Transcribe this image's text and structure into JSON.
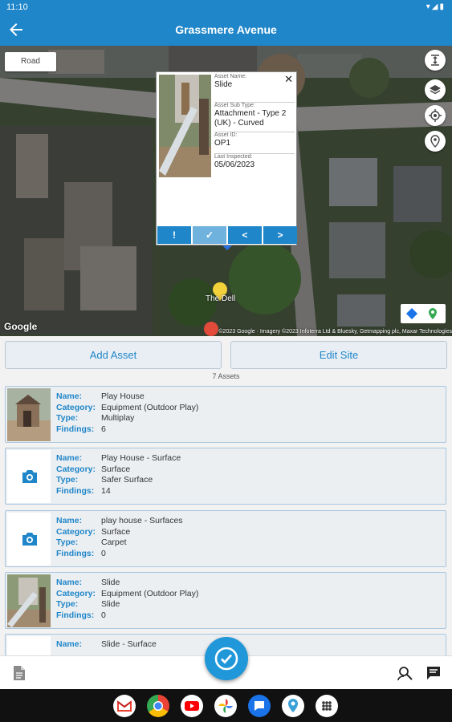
{
  "status": {
    "time": "11:10",
    "system_icons": "▾◢▮"
  },
  "appbar": {
    "title": "Grassmere Avenue"
  },
  "map": {
    "type_button": "Road",
    "google_logo": "Google",
    "attribution": "©2023 Google · Imagery ©2023 Infoterra Ltd & Bluesky, Getmapping plc, Maxar Technologies",
    "poi_label": "The Dell"
  },
  "popup": {
    "asset_name_label": "Asset Name:",
    "asset_name": "Slide",
    "sub_type_label": "Asset Sub Type:",
    "sub_type": "Attachment - Type 2 (UK) - Curved",
    "asset_id_label": "Asset ID:",
    "asset_id": "OP1",
    "last_inspected_label": "Last Inspected:",
    "last_inspected": "05/06/2023",
    "close": "✕",
    "actions": [
      "!",
      "✓",
      "<",
      ">"
    ]
  },
  "buttons": {
    "add_asset": "Add Asset",
    "edit_site": "Edit Site"
  },
  "asset_count": "7 Assets",
  "labels": {
    "name": "Name:",
    "category": "Category:",
    "type": "Type:",
    "findings": "Findings:"
  },
  "assets": [
    {
      "name": "Play House",
      "category": "Equipment (Outdoor Play)",
      "type": "Multiplay",
      "findings": "6",
      "thumb": "photo-playhouse"
    },
    {
      "name": "Play House - Surface",
      "category": "Surface",
      "type": "Safer Surface",
      "findings": "14",
      "thumb": "camera-icon"
    },
    {
      "name": "play house - Surfaces",
      "category": "Surface",
      "type": "Carpet",
      "findings": "0",
      "thumb": "camera-icon"
    },
    {
      "name": "Slide",
      "category": "Equipment (Outdoor Play)",
      "type": "Slide",
      "findings": "0",
      "thumb": "photo-slide"
    },
    {
      "name": "Slide - Surface",
      "category": "",
      "type": "",
      "findings": "",
      "thumb": "camera-icon"
    }
  ],
  "colors": {
    "primary": "#1f86c9",
    "fab": "#1f97d9",
    "card_border": "#a9c6de",
    "label": "#1f86c9"
  },
  "icons": [
    "back-arrow-icon",
    "height-icon",
    "layers-icon",
    "locate-icon",
    "pin-icon",
    "close-icon",
    "camera-icon",
    "document-icon",
    "search-person-icon",
    "chat-icon",
    "check-circle-icon"
  ]
}
